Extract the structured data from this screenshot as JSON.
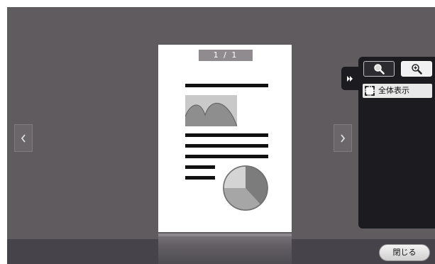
{
  "viewer": {
    "page_counter": {
      "current": "1",
      "separator": "/",
      "total": "1"
    }
  },
  "side_panel": {
    "fit_label": "全体表示",
    "zoom_out_icon": "zoom-out-icon",
    "zoom_in_icon": "zoom-in-icon",
    "fit_icon": "fit-page-icon",
    "toggle_icon": "double-chevron-right-icon"
  },
  "footer": {
    "close_label": "閉じる"
  },
  "colors": {
    "background": "#5f5b5e",
    "panel": "#1c1b1f",
    "bottom_bar": "#46434a"
  }
}
